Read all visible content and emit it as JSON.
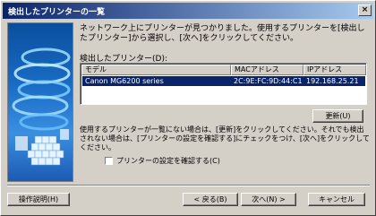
{
  "window": {
    "title": "検出したプリンターの一覧",
    "close_glyph": "×"
  },
  "description": "ネットワーク上にプリンターが見つかりました。使用するプリンターを[検出したプリンター]から選択し、[次へ]をクリックしてください。",
  "printer_list": {
    "label": "検出したプリンター(D):",
    "columns": [
      "モデル",
      "MACアドレス",
      "IPアドレス"
    ],
    "rows": [
      {
        "model": "Canon MG6200 series",
        "mac": "2C:9E:FC:9D:44:C1",
        "ip": "192.168.25.21",
        "selected": true
      }
    ]
  },
  "refresh_button": "更新(U)",
  "note": "使用するプリンターが一覧にない場合は、[更新]をクリックしてください。それでも検出されない場合は、[プリンターの設定を確認する]にチェックをつけ、[次へ]をクリックしてください。",
  "confirm_checkbox": {
    "label": "プリンターの設定を確認する(C)",
    "checked": false
  },
  "footer": {
    "help_button": "操作説明(H)",
    "back_button": "< 戻る(B)",
    "next_button": "次へ(N) >",
    "cancel_button": "キャンセル"
  },
  "colors": {
    "titlebar_start": "#0a246a",
    "titlebar_end": "#a6caf0",
    "selection": "#0a246a",
    "face": "#d4d0c8"
  }
}
